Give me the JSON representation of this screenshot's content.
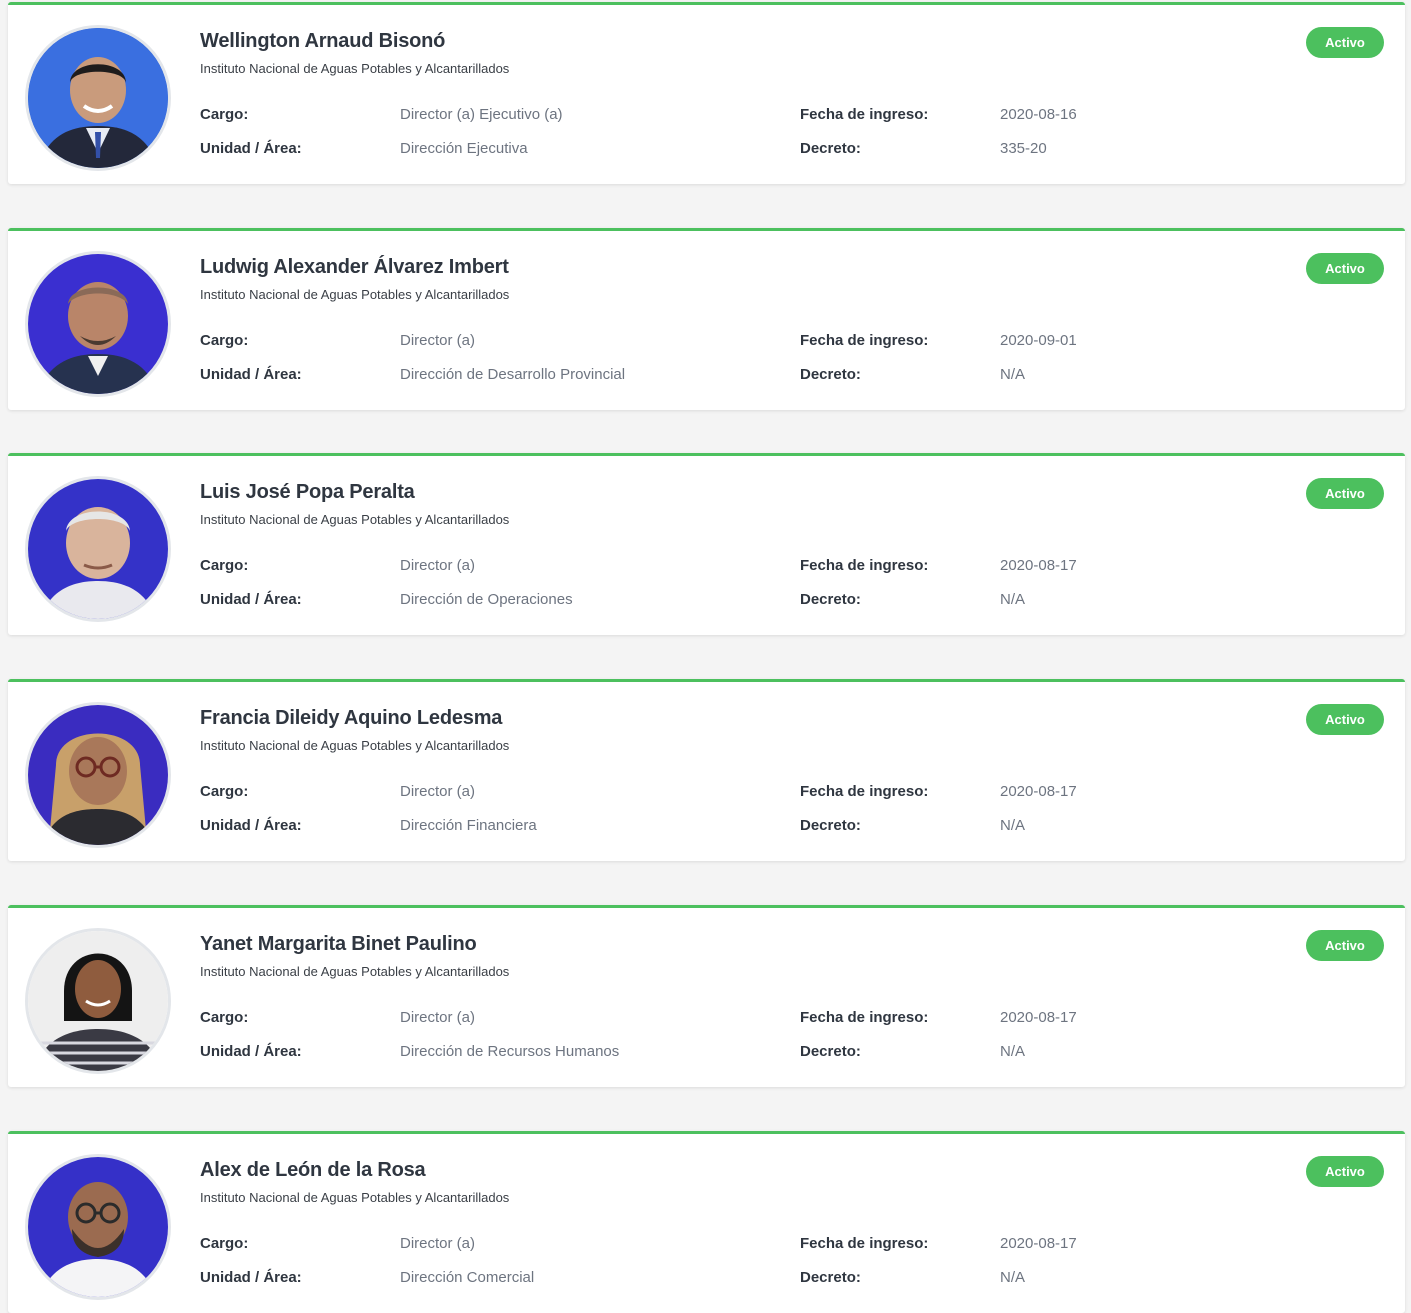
{
  "colors": {
    "accent": "#4cc05e",
    "name_text": "#2f3640",
    "value_text": "#6d7480",
    "page_background": "#f4f4f4"
  },
  "labels": {
    "cargo": "Cargo:",
    "unidad": "Unidad / Área:",
    "fecha": "Fecha de ingreso:",
    "decreto": "Decreto:"
  },
  "officials": [
    {
      "name": "Wellington Arnaud Bisonó",
      "organization": "Instituto Nacional de Aguas Potables y Alcantarillados",
      "cargo": "Director (a) Ejecutivo (a)",
      "unidad": "Dirección Ejecutiva",
      "fecha_ingreso": "2020-08-16",
      "decreto": "335-20",
      "status": "Activo",
      "photo_icon": "profile-photo-icon"
    },
    {
      "name": "Ludwig Alexander Álvarez Imbert",
      "organization": "Instituto Nacional de Aguas Potables y Alcantarillados",
      "cargo": "Director (a)",
      "unidad": "Dirección de Desarrollo Provincial",
      "fecha_ingreso": "2020-09-01",
      "decreto": "N/A",
      "status": "Activo",
      "photo_icon": "profile-photo-icon"
    },
    {
      "name": "Luis José Popa Peralta",
      "organization": "Instituto Nacional de Aguas Potables y Alcantarillados",
      "cargo": "Director (a)",
      "unidad": "Dirección de Operaciones",
      "fecha_ingreso": "2020-08-17",
      "decreto": "N/A",
      "status": "Activo",
      "photo_icon": "profile-photo-icon"
    },
    {
      "name": "Francia Dileidy Aquino Ledesma",
      "organization": "Instituto Nacional de Aguas Potables y Alcantarillados",
      "cargo": "Director (a)",
      "unidad": "Dirección Financiera",
      "fecha_ingreso": "2020-08-17",
      "decreto": "N/A",
      "status": "Activo",
      "photo_icon": "profile-photo-icon"
    },
    {
      "name": "Yanet Margarita Binet Paulino",
      "organization": "Instituto Nacional de Aguas Potables y Alcantarillados",
      "cargo": "Director (a)",
      "unidad": "Dirección de Recursos Humanos",
      "fecha_ingreso": "2020-08-17",
      "decreto": "N/A",
      "status": "Activo",
      "photo_icon": "profile-photo-icon"
    },
    {
      "name": "Alex de León de la Rosa",
      "organization": "Instituto Nacional de Aguas Potables y Alcantarillados",
      "cargo": "Director (a)",
      "unidad": "Dirección Comercial",
      "fecha_ingreso": "2020-08-17",
      "decreto": "N/A",
      "status": "Activo",
      "photo_icon": "profile-photo-icon"
    }
  ]
}
